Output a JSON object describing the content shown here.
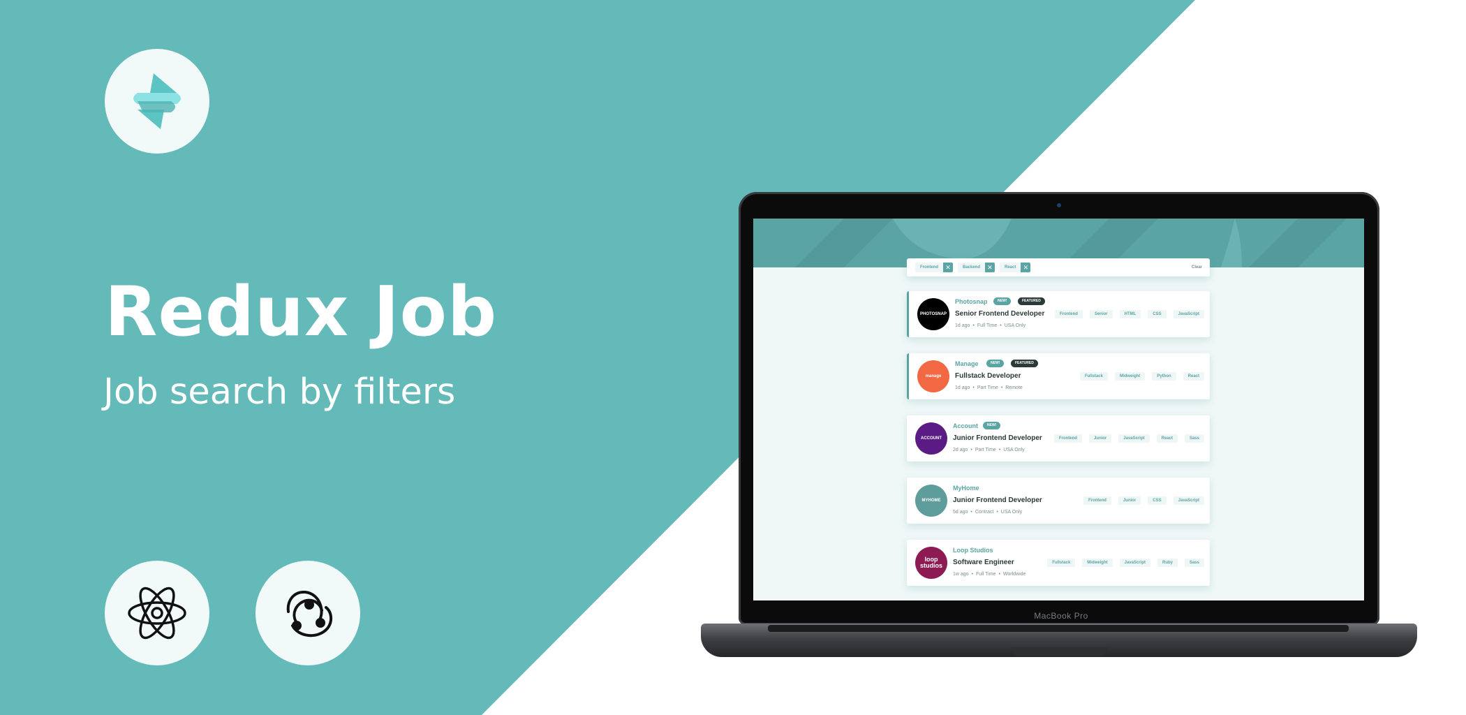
{
  "hero": {
    "title": "Redux Job",
    "subtitle": "Job search by filters"
  },
  "icons": {
    "logo": "app-logo-icon",
    "react": "react-atom-icon",
    "redux": "redux-icon"
  },
  "colors": {
    "teal": "#64b9b9",
    "accent": "#5ba4a4",
    "dark": "#2b3939"
  },
  "laptop": {
    "model": "MacBook Pro"
  },
  "app": {
    "filters": [
      {
        "label": "Frontend"
      },
      {
        "label": "Backend"
      },
      {
        "label": "React"
      }
    ],
    "clear_label": "Clear",
    "jobs": [
      {
        "company": "Photosnap",
        "logo_text": "PHOTOSNAP",
        "logo_color": "#000000",
        "new": "NEW!",
        "featured": "FEATURED",
        "position": "Senior Frontend Developer",
        "posted": "1d ago",
        "contract": "Full Time",
        "location": "USA Only",
        "tools": [
          "Frontend",
          "Senior",
          "HTML",
          "CSS",
          "JavaScript"
        ]
      },
      {
        "company": "Manage",
        "logo_text": "manage",
        "logo_color": "#f26842",
        "new": "NEW!",
        "featured": "FEATURED",
        "position": "Fullstack Developer",
        "posted": "1d ago",
        "contract": "Part Time",
        "location": "Remote",
        "tools": [
          "Fullstack",
          "Midweight",
          "Python",
          "React"
        ]
      },
      {
        "company": "Account",
        "logo_text": "ACCOUNT",
        "logo_color": "#5a1c84",
        "new": "NEW!",
        "featured": "",
        "position": "Junior Frontend Developer",
        "posted": "2d ago",
        "contract": "Part Time",
        "location": "USA Only",
        "tools": [
          "Frontend",
          "Junior",
          "JavaScript",
          "React",
          "Sass"
        ]
      },
      {
        "company": "MyHome",
        "logo_text": "MYHOME",
        "logo_color": "#5e9d9b",
        "new": "",
        "featured": "",
        "position": "Junior Frontend Developer",
        "posted": "5d ago",
        "contract": "Contract",
        "location": "USA Only",
        "tools": [
          "Frontend",
          "Junior",
          "CSS",
          "JavaScript"
        ]
      },
      {
        "company": "Loop Studios",
        "logo_text": "loop studios",
        "logo_color": "#8e1a54",
        "new": "",
        "featured": "",
        "position": "Software Engineer",
        "posted": "1w ago",
        "contract": "Full Time",
        "location": "Worldwide",
        "tools": [
          "Fullstack",
          "Midweight",
          "JavaScript",
          "Ruby",
          "Sass"
        ]
      }
    ]
  }
}
